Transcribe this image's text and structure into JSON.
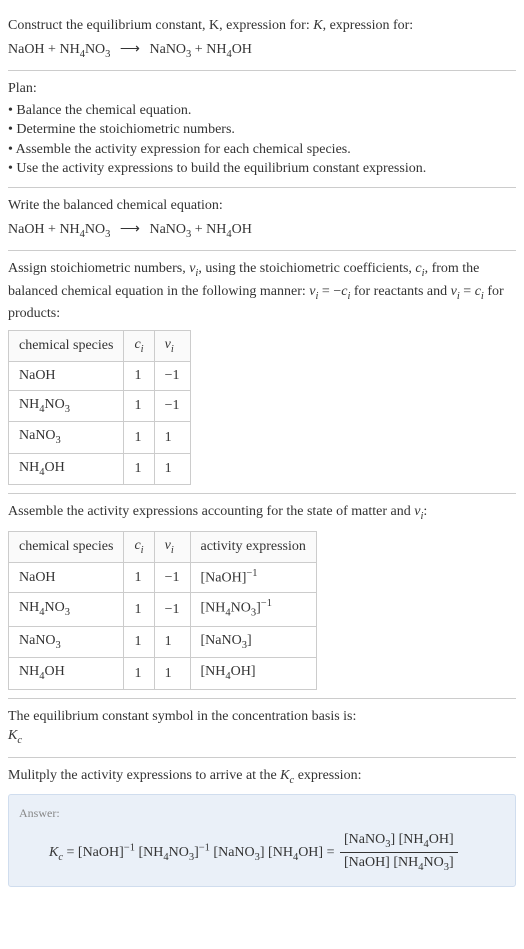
{
  "intro": {
    "line1": "Construct the equilibrium constant, K, expression for:",
    "equation_lhs1": "NaOH",
    "equation_lhs2": "NH",
    "equation_lhs2_sub1": "4",
    "equation_lhs2_part2": "NO",
    "equation_lhs2_sub2": "3",
    "arrow": "⟶",
    "equation_rhs1": "NaNO",
    "equation_rhs1_sub": "3",
    "equation_rhs2": "NH",
    "equation_rhs2_sub1": "4",
    "equation_rhs2_part2": "OH"
  },
  "plan": {
    "title": "Plan:",
    "items": [
      "Balance the chemical equation.",
      "Determine the stoichiometric numbers.",
      "Assemble the activity expression for each chemical species.",
      "Use the activity expressions to build the equilibrium constant expression."
    ]
  },
  "balanced": {
    "title": "Write the balanced chemical equation:"
  },
  "stoich_intro": {
    "part1": "Assign stoichiometric numbers, ",
    "nu": "ν",
    "sub_i": "i",
    "part2": ", using the stoichiometric coefficients, ",
    "c": "c",
    "part3": ", from the balanced chemical equation in the following manner: ",
    "eq1_lhs": "ν",
    "eq1_rhs": " = −c",
    "part4": " for reactants and ",
    "eq2": " = c",
    "part5": " for products:"
  },
  "table1": {
    "headers": [
      "chemical species",
      "cᵢ",
      "νᵢ"
    ],
    "rows": [
      [
        "NaOH",
        "1",
        "−1"
      ],
      [
        "NH₄NO₃",
        "1",
        "−1"
      ],
      [
        "NaNO₃",
        "1",
        "1"
      ],
      [
        "NH₄OH",
        "1",
        "1"
      ]
    ]
  },
  "activity_intro": "Assemble the activity expressions accounting for the state of matter and νᵢ:",
  "table2": {
    "headers": [
      "chemical species",
      "cᵢ",
      "νᵢ",
      "activity expression"
    ],
    "rows": [
      {
        "species": "NaOH",
        "c": "1",
        "nu": "−1",
        "expr_base": "[NaOH]",
        "expr_sup": "−1"
      },
      {
        "species": "NH₄NO₃",
        "c": "1",
        "nu": "−1",
        "expr_base": "[NH₄NO₃]",
        "expr_sup": "−1"
      },
      {
        "species": "NaNO₃",
        "c": "1",
        "nu": "1",
        "expr_base": "[NaNO₃]",
        "expr_sup": ""
      },
      {
        "species": "NH₄OH",
        "c": "1",
        "nu": "1",
        "expr_base": "[NH₄OH]",
        "expr_sup": ""
      }
    ]
  },
  "symbol_intro": "The equilibrium constant symbol in the concentration basis is:",
  "symbol": "K",
  "symbol_sub": "c",
  "multiply_intro": "Mulitply the activity expressions to arrive at the Kc expression:",
  "answer": {
    "label": "Answer:",
    "lhs": "K",
    "lhs_sub": "c",
    "eq": " = [NaOH]",
    "sup1": "−1",
    "part2": " [NH₄NO₃]",
    "sup2": "−1",
    "part3": " [NaNO₃] [NH₄OH] = ",
    "frac_num": "[NaNO₃] [NH₄OH]",
    "frac_den": "[NaOH] [NH₄NO₃]"
  }
}
